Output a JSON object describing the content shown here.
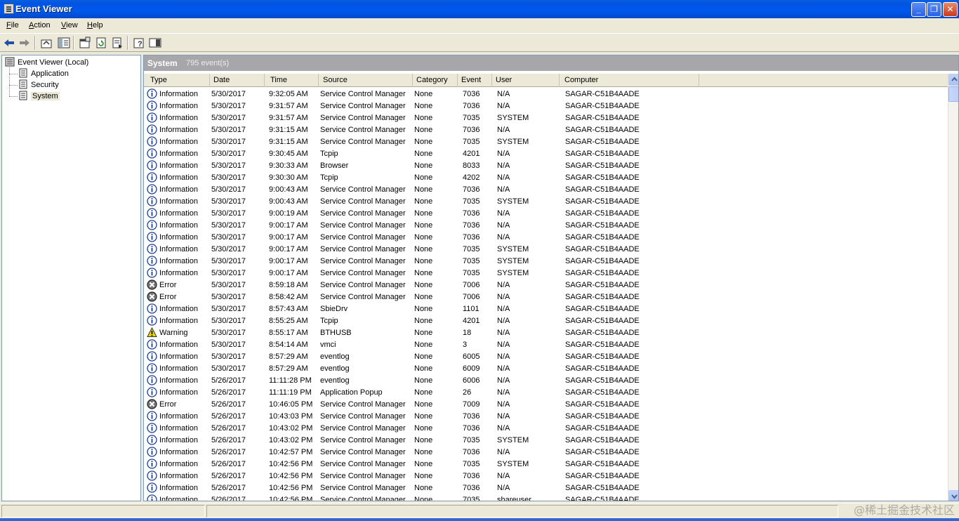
{
  "window": {
    "title": "Event Viewer",
    "controls": {
      "minimize": "_",
      "maximize": "❐",
      "close": "✕"
    }
  },
  "menu": [
    {
      "accel": "F",
      "rest": "ile"
    },
    {
      "accel": "A",
      "rest": "ction"
    },
    {
      "accel": "V",
      "rest": "iew"
    },
    {
      "accel": "H",
      "rest": "elp"
    }
  ],
  "tree": {
    "root": "Event Viewer (Local)",
    "children": [
      "Application",
      "Security",
      "System"
    ],
    "selected": "System"
  },
  "pane": {
    "name": "System",
    "count": "795 event(s)"
  },
  "columns": [
    "Type",
    "Date",
    "Time",
    "Source",
    "Category",
    "Event",
    "User",
    "Computer"
  ],
  "rows": [
    {
      "type": "Information",
      "date": "5/30/2017",
      "time": "9:32:05 AM",
      "source": "Service Control Manager",
      "category": "None",
      "event": "7036",
      "user": "N/A",
      "computer": "SAGAR-C51B4AADE"
    },
    {
      "type": "Information",
      "date": "5/30/2017",
      "time": "9:31:57 AM",
      "source": "Service Control Manager",
      "category": "None",
      "event": "7036",
      "user": "N/A",
      "computer": "SAGAR-C51B4AADE"
    },
    {
      "type": "Information",
      "date": "5/30/2017",
      "time": "9:31:57 AM",
      "source": "Service Control Manager",
      "category": "None",
      "event": "7035",
      "user": "SYSTEM",
      "computer": "SAGAR-C51B4AADE"
    },
    {
      "type": "Information",
      "date": "5/30/2017",
      "time": "9:31:15 AM",
      "source": "Service Control Manager",
      "category": "None",
      "event": "7036",
      "user": "N/A",
      "computer": "SAGAR-C51B4AADE"
    },
    {
      "type": "Information",
      "date": "5/30/2017",
      "time": "9:31:15 AM",
      "source": "Service Control Manager",
      "category": "None",
      "event": "7035",
      "user": "SYSTEM",
      "computer": "SAGAR-C51B4AADE"
    },
    {
      "type": "Information",
      "date": "5/30/2017",
      "time": "9:30:45 AM",
      "source": "Tcpip",
      "category": "None",
      "event": "4201",
      "user": "N/A",
      "computer": "SAGAR-C51B4AADE"
    },
    {
      "type": "Information",
      "date": "5/30/2017",
      "time": "9:30:33 AM",
      "source": "Browser",
      "category": "None",
      "event": "8033",
      "user": "N/A",
      "computer": "SAGAR-C51B4AADE"
    },
    {
      "type": "Information",
      "date": "5/30/2017",
      "time": "9:30:30 AM",
      "source": "Tcpip",
      "category": "None",
      "event": "4202",
      "user": "N/A",
      "computer": "SAGAR-C51B4AADE"
    },
    {
      "type": "Information",
      "date": "5/30/2017",
      "time": "9:00:43 AM",
      "source": "Service Control Manager",
      "category": "None",
      "event": "7036",
      "user": "N/A",
      "computer": "SAGAR-C51B4AADE"
    },
    {
      "type": "Information",
      "date": "5/30/2017",
      "time": "9:00:43 AM",
      "source": "Service Control Manager",
      "category": "None",
      "event": "7035",
      "user": "SYSTEM",
      "computer": "SAGAR-C51B4AADE"
    },
    {
      "type": "Information",
      "date": "5/30/2017",
      "time": "9:00:19 AM",
      "source": "Service Control Manager",
      "category": "None",
      "event": "7036",
      "user": "N/A",
      "computer": "SAGAR-C51B4AADE"
    },
    {
      "type": "Information",
      "date": "5/30/2017",
      "time": "9:00:17 AM",
      "source": "Service Control Manager",
      "category": "None",
      "event": "7036",
      "user": "N/A",
      "computer": "SAGAR-C51B4AADE"
    },
    {
      "type": "Information",
      "date": "5/30/2017",
      "time": "9:00:17 AM",
      "source": "Service Control Manager",
      "category": "None",
      "event": "7036",
      "user": "N/A",
      "computer": "SAGAR-C51B4AADE"
    },
    {
      "type": "Information",
      "date": "5/30/2017",
      "time": "9:00:17 AM",
      "source": "Service Control Manager",
      "category": "None",
      "event": "7035",
      "user": "SYSTEM",
      "computer": "SAGAR-C51B4AADE"
    },
    {
      "type": "Information",
      "date": "5/30/2017",
      "time": "9:00:17 AM",
      "source": "Service Control Manager",
      "category": "None",
      "event": "7035",
      "user": "SYSTEM",
      "computer": "SAGAR-C51B4AADE"
    },
    {
      "type": "Information",
      "date": "5/30/2017",
      "time": "9:00:17 AM",
      "source": "Service Control Manager",
      "category": "None",
      "event": "7035",
      "user": "SYSTEM",
      "computer": "SAGAR-C51B4AADE"
    },
    {
      "type": "Error",
      "date": "5/30/2017",
      "time": "8:59:18 AM",
      "source": "Service Control Manager",
      "category": "None",
      "event": "7006",
      "user": "N/A",
      "computer": "SAGAR-C51B4AADE"
    },
    {
      "type": "Error",
      "date": "5/30/2017",
      "time": "8:58:42 AM",
      "source": "Service Control Manager",
      "category": "None",
      "event": "7006",
      "user": "N/A",
      "computer": "SAGAR-C51B4AADE"
    },
    {
      "type": "Information",
      "date": "5/30/2017",
      "time": "8:57:43 AM",
      "source": "SbieDrv",
      "category": "None",
      "event": "1101",
      "user": "N/A",
      "computer": "SAGAR-C51B4AADE"
    },
    {
      "type": "Information",
      "date": "5/30/2017",
      "time": "8:55:25 AM",
      "source": "Tcpip",
      "category": "None",
      "event": "4201",
      "user": "N/A",
      "computer": "SAGAR-C51B4AADE"
    },
    {
      "type": "Warning",
      "date": "5/30/2017",
      "time": "8:55:17 AM",
      "source": "BTHUSB",
      "category": "None",
      "event": "18",
      "user": "N/A",
      "computer": "SAGAR-C51B4AADE"
    },
    {
      "type": "Information",
      "date": "5/30/2017",
      "time": "8:54:14 AM",
      "source": "vmci",
      "category": "None",
      "event": "3",
      "user": "N/A",
      "computer": "SAGAR-C51B4AADE"
    },
    {
      "type": "Information",
      "date": "5/30/2017",
      "time": "8:57:29 AM",
      "source": "eventlog",
      "category": "None",
      "event": "6005",
      "user": "N/A",
      "computer": "SAGAR-C51B4AADE"
    },
    {
      "type": "Information",
      "date": "5/30/2017",
      "time": "8:57:29 AM",
      "source": "eventlog",
      "category": "None",
      "event": "6009",
      "user": "N/A",
      "computer": "SAGAR-C51B4AADE"
    },
    {
      "type": "Information",
      "date": "5/26/2017",
      "time": "11:11:28 PM",
      "source": "eventlog",
      "category": "None",
      "event": "6006",
      "user": "N/A",
      "computer": "SAGAR-C51B4AADE"
    },
    {
      "type": "Information",
      "date": "5/26/2017",
      "time": "11:11:19 PM",
      "source": "Application Popup",
      "category": "None",
      "event": "26",
      "user": "N/A",
      "computer": "SAGAR-C51B4AADE"
    },
    {
      "type": "Error",
      "date": "5/26/2017",
      "time": "10:46:05 PM",
      "source": "Service Control Manager",
      "category": "None",
      "event": "7009",
      "user": "N/A",
      "computer": "SAGAR-C51B4AADE"
    },
    {
      "type": "Information",
      "date": "5/26/2017",
      "time": "10:43:03 PM",
      "source": "Service Control Manager",
      "category": "None",
      "event": "7036",
      "user": "N/A",
      "computer": "SAGAR-C51B4AADE"
    },
    {
      "type": "Information",
      "date": "5/26/2017",
      "time": "10:43:02 PM",
      "source": "Service Control Manager",
      "category": "None",
      "event": "7036",
      "user": "N/A",
      "computer": "SAGAR-C51B4AADE"
    },
    {
      "type": "Information",
      "date": "5/26/2017",
      "time": "10:43:02 PM",
      "source": "Service Control Manager",
      "category": "None",
      "event": "7035",
      "user": "SYSTEM",
      "computer": "SAGAR-C51B4AADE"
    },
    {
      "type": "Information",
      "date": "5/26/2017",
      "time": "10:42:57 PM",
      "source": "Service Control Manager",
      "category": "None",
      "event": "7036",
      "user": "N/A",
      "computer": "SAGAR-C51B4AADE"
    },
    {
      "type": "Information",
      "date": "5/26/2017",
      "time": "10:42:56 PM",
      "source": "Service Control Manager",
      "category": "None",
      "event": "7035",
      "user": "SYSTEM",
      "computer": "SAGAR-C51B4AADE"
    },
    {
      "type": "Information",
      "date": "5/26/2017",
      "time": "10:42:56 PM",
      "source": "Service Control Manager",
      "category": "None",
      "event": "7036",
      "user": "N/A",
      "computer": "SAGAR-C51B4AADE"
    },
    {
      "type": "Information",
      "date": "5/26/2017",
      "time": "10:42:56 PM",
      "source": "Service Control Manager",
      "category": "None",
      "event": "7036",
      "user": "N/A",
      "computer": "SAGAR-C51B4AADE"
    },
    {
      "type": "Information",
      "date": "5/26/2017",
      "time": "10:42:56 PM",
      "source": "Service Control Manager",
      "category": "None",
      "event": "7035",
      "user": "shareuser",
      "computer": "SAGAR-C51B4AADE"
    }
  ],
  "watermark": "@稀土掘金技术社区",
  "colors": {
    "titlebar": "#0054e3",
    "chrome": "#ece9d8",
    "pane_header": "#a7a6aa"
  }
}
